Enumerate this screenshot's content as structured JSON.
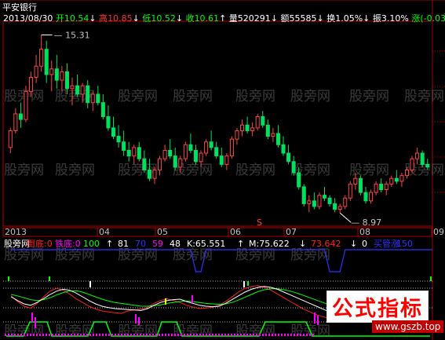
{
  "top_title": "平安银行",
  "header": {
    "date": "2013/08/30",
    "open": {
      "label": "开",
      "value": "10.54",
      "arrow": "↓"
    },
    "high": {
      "label": "高",
      "value": "10.85",
      "arrow": "↓"
    },
    "low": {
      "label": "低",
      "value": "10.52",
      "arrow": "↓"
    },
    "close": {
      "label": "收",
      "value": "10.61",
      "arrow": "↑"
    },
    "volume": {
      "label": "量",
      "value": "520291",
      "arrow": "↓"
    },
    "amount": {
      "label": "额",
      "value": "55585",
      "arrow": "↓"
    },
    "turnover": {
      "label": "换",
      "value": "1.05%",
      "arrow": "↓"
    },
    "amplitude": {
      "label": "振",
      "value": "3.10%"
    },
    "change": {
      "label": "涨",
      "value": "(-0.03)",
      "extra": "-0."
    }
  },
  "colors": {
    "up": "#ff4444",
    "down": "#00e060",
    "up_body": "#000000",
    "grid": "#b00000",
    "cyan": "#00ffff",
    "white": "#ffffff",
    "green": "#00ff00",
    "yellow": "#ffff00",
    "magenta": "#ff00ff",
    "blue": "#3030ff"
  },
  "watermark": "股旁网",
  "marker_s": "S",
  "chart_data": {
    "type": "candlestick",
    "title": "平安银行",
    "ylim": [
      8.5,
      15.8
    ],
    "max_label": "15.31",
    "min_label": "8.97",
    "candles": [
      [
        11.3,
        12.0,
        11.1,
        11.9
      ],
      [
        11.9,
        12.7,
        11.8,
        12.5
      ],
      [
        12.5,
        12.9,
        12.0,
        12.3
      ],
      [
        12.3,
        13.5,
        12.2,
        13.3
      ],
      [
        13.3,
        14.0,
        13.1,
        13.8
      ],
      [
        13.8,
        14.6,
        13.6,
        14.2
      ],
      [
        14.2,
        15.31,
        14.0,
        14.8
      ],
      [
        14.8,
        15.1,
        13.6,
        13.9
      ],
      [
        13.9,
        14.4,
        13.3,
        14.1
      ],
      [
        14.1,
        14.6,
        13.4,
        13.7
      ],
      [
        13.7,
        14.2,
        13.3,
        14.0
      ],
      [
        14.0,
        14.3,
        13.2,
        13.4
      ],
      [
        13.4,
        13.8,
        12.8,
        13.5
      ],
      [
        13.5,
        13.9,
        13.1,
        13.2
      ],
      [
        13.2,
        13.6,
        12.9,
        13.5
      ],
      [
        13.5,
        13.7,
        12.7,
        12.9
      ],
      [
        12.9,
        13.3,
        12.6,
        13.2
      ],
      [
        13.2,
        13.5,
        12.8,
        12.9
      ],
      [
        12.9,
        13.2,
        12.3,
        12.4
      ],
      [
        12.4,
        12.8,
        11.9,
        12.0
      ],
      [
        12.0,
        12.4,
        11.6,
        11.7
      ],
      [
        11.7,
        12.1,
        11.3,
        11.5
      ],
      [
        11.5,
        11.9,
        11.0,
        11.2
      ],
      [
        11.2,
        11.5,
        10.8,
        11.0
      ],
      [
        11.0,
        11.4,
        10.7,
        11.3
      ],
      [
        11.3,
        11.5,
        10.8,
        10.9
      ],
      [
        10.9,
        11.2,
        10.4,
        10.5
      ],
      [
        10.5,
        10.9,
        10.1,
        10.2
      ],
      [
        10.2,
        10.6,
        10.0,
        10.5
      ],
      [
        10.5,
        11.0,
        10.3,
        10.9
      ],
      [
        10.9,
        11.4,
        10.8,
        11.2
      ],
      [
        11.2,
        11.6,
        10.9,
        11.0
      ],
      [
        11.0,
        11.3,
        10.5,
        10.6
      ],
      [
        10.6,
        11.0,
        10.4,
        10.9
      ],
      [
        10.9,
        11.5,
        10.8,
        11.4
      ],
      [
        11.4,
        11.8,
        11.1,
        11.2
      ],
      [
        11.2,
        11.4,
        10.7,
        10.8
      ],
      [
        10.8,
        11.2,
        10.6,
        11.1
      ],
      [
        11.1,
        11.6,
        11.0,
        11.5
      ],
      [
        11.5,
        11.9,
        11.2,
        11.3
      ],
      [
        11.3,
        11.5,
        10.9,
        11.0
      ],
      [
        11.0,
        11.3,
        10.6,
        10.7
      ],
      [
        10.7,
        11.1,
        10.5,
        11.0
      ],
      [
        11.0,
        11.7,
        10.9,
        11.6
      ],
      [
        11.6,
        12.0,
        11.4,
        11.9
      ],
      [
        11.9,
        12.3,
        11.7,
        12.1
      ],
      [
        12.1,
        12.4,
        11.8,
        11.9
      ],
      [
        11.9,
        12.2,
        11.7,
        12.0
      ],
      [
        12.0,
        12.5,
        11.9,
        12.4
      ],
      [
        12.4,
        12.6,
        12.0,
        12.1
      ],
      [
        12.1,
        12.3,
        11.6,
        11.7
      ],
      [
        11.7,
        12.0,
        11.5,
        11.8
      ],
      [
        11.8,
        12.1,
        11.3,
        11.4
      ],
      [
        11.4,
        11.7,
        11.0,
        11.1
      ],
      [
        11.1,
        11.4,
        10.7,
        10.8
      ],
      [
        10.8,
        11.0,
        10.3,
        10.4
      ],
      [
        10.4,
        10.6,
        9.8,
        9.9
      ],
      [
        9.9,
        10.0,
        9.2,
        9.3
      ],
      [
        9.3,
        9.6,
        9.0,
        9.4
      ],
      [
        9.4,
        9.7,
        9.1,
        9.2
      ],
      [
        9.2,
        9.7,
        9.1,
        9.6
      ],
      [
        9.6,
        9.9,
        9.4,
        9.5
      ],
      [
        9.5,
        9.6,
        9.2,
        9.3
      ],
      [
        9.3,
        9.5,
        9.0,
        9.1
      ],
      [
        9.1,
        9.3,
        8.97,
        9.2
      ],
      [
        9.2,
        9.6,
        9.1,
        9.5
      ],
      [
        9.5,
        10.1,
        9.4,
        10.0
      ],
      [
        10.0,
        10.4,
        9.8,
        10.2
      ],
      [
        10.2,
        10.3,
        9.6,
        9.7
      ],
      [
        9.7,
        9.9,
        9.3,
        9.4
      ],
      [
        9.4,
        9.8,
        9.3,
        9.7
      ],
      [
        9.7,
        10.1,
        9.6,
        10.0
      ],
      [
        10.0,
        10.2,
        9.7,
        9.8
      ],
      [
        9.8,
        10.1,
        9.6,
        10.0
      ],
      [
        10.0,
        10.3,
        9.9,
        10.2
      ],
      [
        10.2,
        10.5,
        10.0,
        10.1
      ],
      [
        10.1,
        10.4,
        9.9,
        10.3
      ],
      [
        10.3,
        10.6,
        10.2,
        10.5
      ],
      [
        10.5,
        11.0,
        10.4,
        10.9
      ],
      [
        10.9,
        11.3,
        10.7,
        11.1
      ],
      [
        11.1,
        11.2,
        10.6,
        10.7
      ],
      [
        10.7,
        10.9,
        10.52,
        10.61
      ]
    ],
    "x_labels": [
      "2013",
      "04",
      "05",
      "06",
      "07",
      "08",
      "09"
    ],
    "indicator_legend": [
      {
        "text": "股旁网",
        "color": "#ffffff"
      },
      {
        "text": "倒底:0",
        "color": "#ff2020"
      },
      {
        "text": "铁底:0",
        "color": "#ff00ff"
      },
      {
        "text": "100",
        "color": "#00ff00"
      },
      {
        "text": "↑",
        "color": "#ffffff"
      },
      {
        "text": "81",
        "color": "#ffffff"
      },
      {
        "text": "70",
        "color": "#3030ff"
      },
      {
        "text": "59",
        "color": "#ff00ff"
      },
      {
        "text": "48",
        "color": "#ffffff"
      },
      {
        "text": "K:65.551",
        "color": "#ffffff"
      },
      {
        "text": "↑",
        "color": "#ffffff"
      },
      {
        "text": "M:75.622",
        "color": "#ffffff"
      },
      {
        "text": "↓",
        "color": "#ffffff"
      },
      {
        "text": "73.642",
        "color": "#ff2020"
      },
      {
        "text": "↓",
        "color": "#ffffff"
      },
      {
        "text": "0",
        "color": "#ffffff"
      },
      {
        "text": "买管涨",
        "color": "#3030ff"
      },
      {
        "text": "150",
        "color": "#3030ff"
      }
    ],
    "indicator_series": {
      "k_white": [
        70,
        62,
        55,
        52,
        58,
        66,
        75,
        82,
        86,
        84,
        78,
        70,
        62,
        55,
        50,
        47,
        45,
        44,
        43,
        42,
        41,
        45,
        52,
        58,
        62,
        64,
        65,
        60,
        56,
        52,
        50,
        49,
        50,
        56,
        64,
        72,
        80,
        86,
        90,
        92,
        90,
        86,
        80,
        74,
        68,
        62,
        56,
        50,
        44,
        38,
        32,
        28,
        25,
        23,
        22,
        21,
        20,
        22,
        26,
        32,
        40,
        50,
        60,
        66,
        65
      ],
      "m_green": [
        75,
        72,
        68,
        64,
        62,
        64,
        68,
        74,
        79,
        82,
        83,
        80,
        75,
        70,
        65,
        61,
        58,
        56,
        54,
        52,
        50,
        50,
        51,
        53,
        56,
        58,
        60,
        61,
        60,
        58,
        56,
        55,
        54,
        55,
        58,
        63,
        69,
        75,
        81,
        85,
        87,
        87,
        85,
        82,
        78,
        73,
        68,
        63,
        58,
        53,
        48,
        43,
        39,
        35,
        32,
        29,
        27,
        26,
        26,
        28,
        32,
        38,
        46,
        56,
        68
      ],
      "red": [
        72,
        60,
        50,
        46,
        56,
        70,
        82,
        88,
        84,
        76,
        66,
        58,
        50,
        44,
        40,
        38,
        36,
        35,
        40,
        42,
        44,
        48,
        56,
        62,
        66,
        62,
        58,
        52,
        48,
        45,
        46,
        48,
        52,
        60,
        70,
        80,
        88,
        92,
        94,
        90,
        84,
        76,
        68,
        60,
        52,
        44,
        38,
        32,
        28,
        24,
        20,
        18,
        18,
        20,
        24,
        28,
        34,
        40,
        46,
        56,
        70,
        78,
        74,
        70,
        72
      ],
      "blue_step": [
        0,
        0,
        0,
        0,
        0,
        0,
        0,
        0,
        0,
        0,
        0,
        0,
        0,
        0,
        0,
        0,
        0,
        0,
        0,
        0,
        0,
        0,
        0,
        0,
        0,
        0,
        0,
        0,
        0,
        0,
        0,
        0,
        0,
        0,
        0,
        0,
        1,
        1,
        0,
        0,
        0,
        0,
        0,
        0,
        0,
        0,
        0,
        0,
        0,
        0,
        0,
        0,
        0,
        0,
        0,
        0,
        0,
        0,
        0,
        0,
        0,
        0,
        1,
        1,
        1,
        0,
        0,
        0,
        0,
        0,
        0,
        0,
        0,
        0,
        0,
        0,
        0,
        0,
        0,
        0,
        0,
        0,
        0
      ]
    }
  },
  "logo_text": "公式指标",
  "logo_url": "www.gszb.top"
}
